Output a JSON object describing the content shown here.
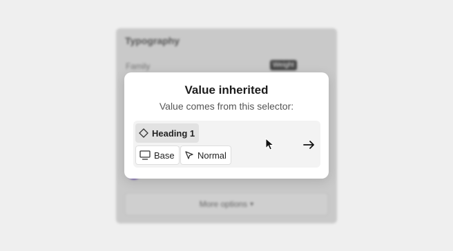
{
  "background_panel": {
    "title": "Typography",
    "field_label": "Family",
    "badge": "Weight",
    "more_options_label": "More options"
  },
  "popover": {
    "title": "Value inherited",
    "subtitle": "Value comes from this selector:",
    "selectors": {
      "heading": "Heading 1",
      "base": "Base",
      "normal": "Normal"
    },
    "go_icon": "arrow-right-icon"
  },
  "colors": {
    "popover_bg": "#ffffff",
    "selector_bg": "#f3f3f3",
    "swatch_purple": "#5b3aa6"
  }
}
